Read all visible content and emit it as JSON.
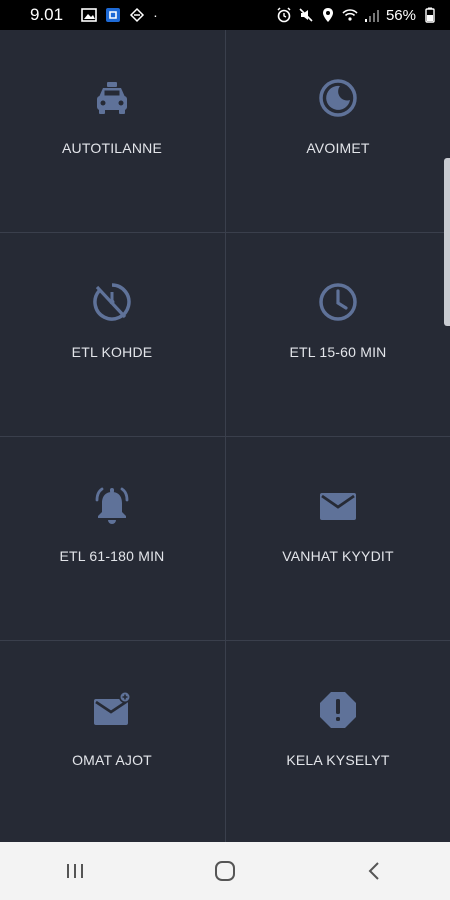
{
  "status_bar": {
    "time": "9.01",
    "battery": "56%",
    "left_icons": [
      "image-icon",
      "app-icon",
      "vpn-icon",
      "dot-icon"
    ],
    "right_icons": [
      "alarm-icon",
      "mute-icon",
      "location-icon",
      "wifi-icon",
      "signal-icon",
      "battery-icon"
    ]
  },
  "tiles": [
    {
      "label": "AUTOTILANNE",
      "icon": "taxi-icon"
    },
    {
      "label": "AVOIMET",
      "icon": "moon-icon"
    },
    {
      "label": "ETL KOHDE",
      "icon": "timer-off-icon"
    },
    {
      "label": "ETL 15-60 MIN",
      "icon": "clock-icon"
    },
    {
      "label": "ETL 61-180 MIN",
      "icon": "bell-icon"
    },
    {
      "label": "VANHAT KYYDIT",
      "icon": "mail-icon"
    },
    {
      "label": "OMAT AJOT",
      "icon": "mail-add-icon"
    },
    {
      "label": "KELA KYSELYT",
      "icon": "alert-octagon-icon"
    }
  ],
  "nav_bar": {
    "buttons": [
      "recent-apps-icon",
      "home-icon",
      "back-icon"
    ]
  },
  "colors": {
    "background": "#262a35",
    "divider": "#3a3f4c",
    "icon": "#5f7299",
    "label": "#e3e5ea",
    "nav_background": "#f3f3f3"
  }
}
